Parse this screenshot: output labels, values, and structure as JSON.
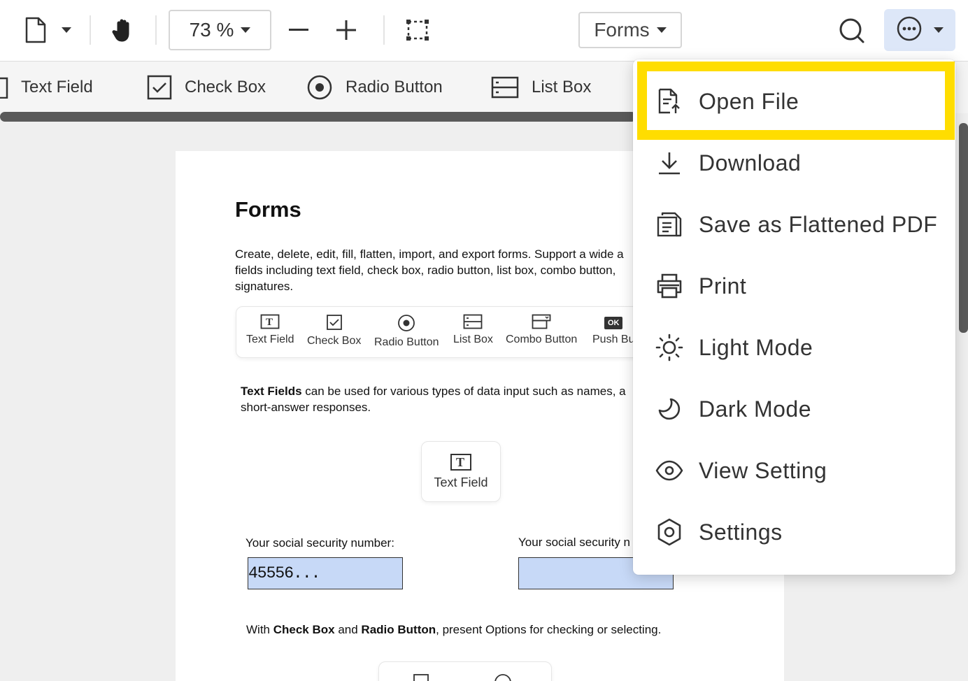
{
  "toolbar": {
    "zoom_value": "73 %",
    "mode_dropdown": "Forms"
  },
  "subbar": {
    "items": [
      {
        "label": "Text Field",
        "icon": "text-field-icon"
      },
      {
        "label": "Check Box",
        "icon": "checkbox-icon"
      },
      {
        "label": "Radio Button",
        "icon": "radio-button-icon"
      },
      {
        "label": "List Box",
        "icon": "list-box-icon"
      }
    ]
  },
  "document": {
    "title": "Forms",
    "intro_lines": [
      "Create, delete, edit, fill, flatten, import, and export forms. Support a wide a",
      "fields including text field, check box, radio button, list box, combo button,",
      "signatures."
    ],
    "card_items": [
      "Text Field",
      "Check Box",
      "Radio Button",
      "List Box",
      "Combo Button",
      "Push Bu"
    ],
    "ok_badge": "OK",
    "text_fields_bold": "Text Fields",
    "text_fields_rest": " can be used for various types of data input such as names, a",
    "text_fields_line2": "short-answer responses.",
    "text_field_card_label": "Text Field",
    "ssn_label_1": "Your social security number:",
    "ssn_label_2": "Your social security n",
    "ssn_value_1": "45556...",
    "ssn_value_2": "",
    "check_line_pre": "With ",
    "check_line_b1": "Check Box",
    "check_line_mid": " and ",
    "check_line_b2": "Radio Button",
    "check_line_post": ", present Options for checking or selecting."
  },
  "menu": {
    "items": [
      {
        "label": "Open File",
        "icon": "open-file-icon"
      },
      {
        "label": "Download",
        "icon": "download-icon"
      },
      {
        "label": "Save as Flattened PDF",
        "icon": "flatten-pdf-icon"
      },
      {
        "label": "Print",
        "icon": "print-icon"
      },
      {
        "label": "Light Mode",
        "icon": "sun-icon"
      },
      {
        "label": "Dark Mode",
        "icon": "moon-icon"
      },
      {
        "label": "View Setting",
        "icon": "eye-icon"
      },
      {
        "label": "Settings",
        "icon": "settings-icon"
      }
    ]
  },
  "colors": {
    "highlight": "#ffdd00",
    "field_fill": "#c7d9f7",
    "more_button_bg": "#dde7f8"
  }
}
